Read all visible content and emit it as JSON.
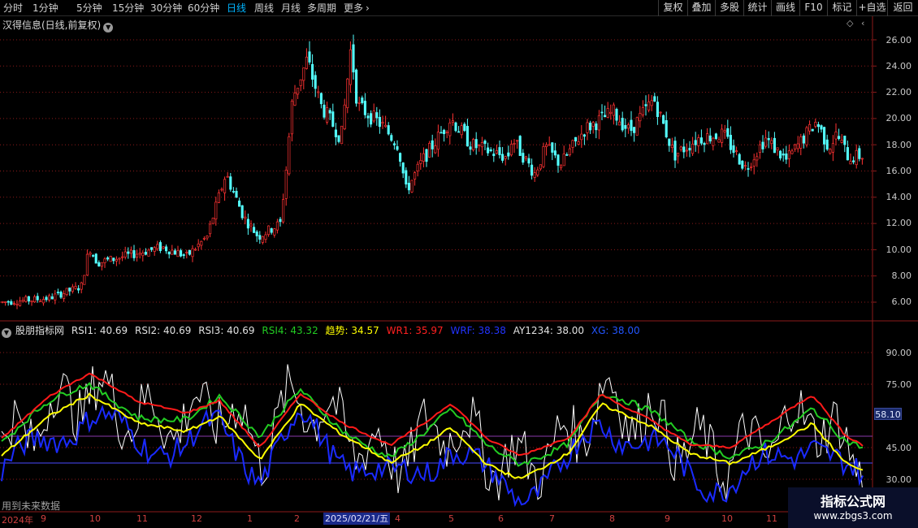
{
  "toolbar": {
    "periods": [
      "分时",
      "1分钟",
      "5分钟",
      "15分钟",
      "30分钟",
      "60分钟",
      "日线",
      "周线",
      "月线",
      "多周期",
      "更多"
    ],
    "active_period": "日线",
    "more_arrow": "›",
    "right_buttons": [
      "复权",
      "叠加",
      "多股",
      "统计",
      "画线",
      "F10",
      "标记",
      "+自选",
      "返回"
    ]
  },
  "chart": {
    "title": "汉得信息(日线,前复权)",
    "title_dropdown": "chevron-down-icon",
    "controls": [
      "◇",
      "‹"
    ],
    "price_labels": [
      "26.00",
      "24.00",
      "22.00",
      "20.00",
      "18.00",
      "16.00",
      "14.00",
      "12.00",
      "10.00",
      "8.00",
      "6.00"
    ]
  },
  "indicator": {
    "name": "股朋指标网",
    "items": [
      {
        "label": "RSI1: 40.69",
        "color": "#e0e0e0"
      },
      {
        "label": "RSI2: 40.69",
        "color": "#e0e0e0"
      },
      {
        "label": "RSI3: 40.69",
        "color": "#e0e0e0"
      },
      {
        "label": "RSI4: 43.32",
        "color": "#22cc22"
      },
      {
        "label": "趋势: 34.57",
        "color": "#ffff00"
      },
      {
        "label": "WR1: 35.97",
        "color": "#ff2020"
      },
      {
        "label": "WRF: 38.38",
        "color": "#2233ff"
      },
      {
        "label": "AY1234: 38.00",
        "color": "#e0e0e0"
      },
      {
        "label": "XG: 38.00",
        "color": "#2255ff"
      }
    ],
    "axis_labels": [
      "90.00",
      "75.00",
      "45.00",
      "30.00"
    ],
    "current_value_tag": "58.10",
    "future_note": "用到未来数据"
  },
  "xaxis": {
    "labels": [
      "2024年",
      "9",
      "10",
      "11",
      "12",
      "1",
      "2",
      "4",
      "5",
      "6",
      "7",
      "8",
      "9",
      "10",
      "11"
    ],
    "cursor_date": "2025/02/21/五"
  },
  "watermark": {
    "title": "指标公式网",
    "url": "www.zbgs3.com"
  },
  "colors": {
    "up": "#ff3232",
    "down": "#54ffff",
    "grid": "#8b1a1a",
    "rsi": "#ffffff",
    "rsi4": "#22cc22",
    "trend": "#ffff00",
    "wr1": "#ff1a1a",
    "wrf": "#1a2aff",
    "ref_line_upper": "#8a3aaa",
    "ref_line_lower": "#4a4aff"
  }
}
